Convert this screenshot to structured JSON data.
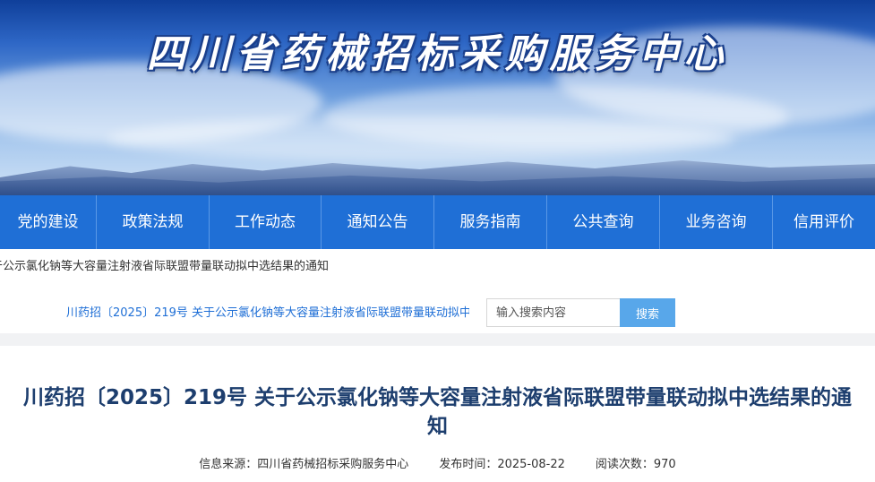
{
  "banner": {
    "title": "四川省药械招标采购服务中心"
  },
  "nav": {
    "items": [
      {
        "label": "党的建设"
      },
      {
        "label": "政策法规"
      },
      {
        "label": "工作动态"
      },
      {
        "label": "通知公告"
      },
      {
        "label": "服务指南"
      },
      {
        "label": "公共查询"
      },
      {
        "label": "业务咨询"
      },
      {
        "label": "信用评价"
      }
    ]
  },
  "breadcrumb": {
    "text": "于公示氯化钠等大容量注射液省际联盟带量联动拟中选结果的通知"
  },
  "ticker": {
    "text": "川药招〔2025〕219号 关于公示氯化钠等大容量注射液省际联盟带量联动拟中选结果的通知"
  },
  "search": {
    "placeholder": "输入搜索内容",
    "button_label": "搜索"
  },
  "article": {
    "title": "川药招〔2025〕219号 关于公示氯化钠等大容量注射液省际联盟带量联动拟中选结果的通知",
    "source": "信息来源：四川省药械招标采购服务中心",
    "published": "发布时间：2025-08-22",
    "reads": "阅读次数：970"
  },
  "colors": {
    "nav_bg": "#1f6fd6",
    "title": "#1d3e6e",
    "ticker": "#1f6fd6",
    "search_button": "#58a7ea"
  }
}
